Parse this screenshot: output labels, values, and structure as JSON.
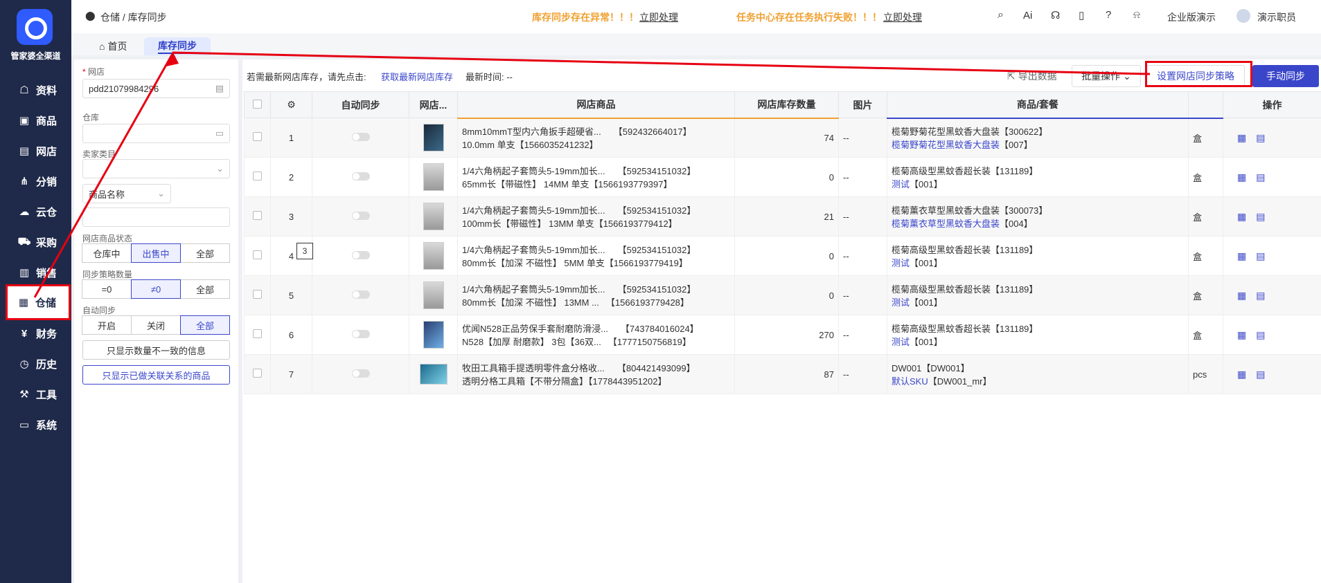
{
  "app": {
    "brand": "管家婆全渠道"
  },
  "sidebar": {
    "items": [
      {
        "label": "资料",
        "icon": "user-icon"
      },
      {
        "label": "商品",
        "icon": "box-icon"
      },
      {
        "label": "网店",
        "icon": "store-icon"
      },
      {
        "label": "分销",
        "icon": "share-icon"
      },
      {
        "label": "云仓",
        "icon": "cloud-warehouse-icon"
      },
      {
        "label": "采购",
        "icon": "cart-icon"
      },
      {
        "label": "销售",
        "icon": "chart-icon"
      },
      {
        "label": "仓储",
        "icon": "warehouse-icon"
      },
      {
        "label": "财务",
        "icon": "finance-icon"
      },
      {
        "label": "历史",
        "icon": "history-icon"
      },
      {
        "label": "工具",
        "icon": "toolbox-icon"
      },
      {
        "label": "系统",
        "icon": "monitor-icon"
      }
    ],
    "active": "仓储"
  },
  "header": {
    "breadcrumb": "仓储 / 库存同步",
    "alert1": "库存同步存在异常！！！",
    "alert1_action": "立即处理",
    "alert2": "任务中心存在任务执行失败！！！",
    "alert2_action": "立即处理",
    "ai_label": "Ai",
    "enterprise": "企业版演示",
    "user": "演示职员"
  },
  "tabs": [
    {
      "label": "首页"
    },
    {
      "label": "库存同步"
    }
  ],
  "filter": {
    "shop_label": "网店",
    "shop_value": "pdd21079984296",
    "warehouse_label": "仓库",
    "category_label": "卖家类目",
    "name_select": "商品名称",
    "status_label": "网店商品状态",
    "status_opts": [
      "仓库中",
      "出售中",
      "全部"
    ],
    "strategy_label": "同步策略数量",
    "strategy_opts": [
      "=0",
      "≠0",
      "全部"
    ],
    "auto_label": "自动同步",
    "auto_opts": [
      "开启",
      "关闭",
      "全部"
    ],
    "btn_mismatch": "只显示数量不一致的信息",
    "btn_linked": "只显示已做关联关系的商品"
  },
  "toolbar": {
    "hint": "若需最新网店库存，请先点击:",
    "hint_link": "获取最新网店库存",
    "latest_time": "最新时间: --",
    "export": "导出数据",
    "batch": "批量操作",
    "set_strategy": "设置网店同步策略",
    "manual_sync": "手动同步"
  },
  "table": {
    "headers": [
      "自动同步",
      "网店...",
      "网店商品",
      "网店库存数量",
      "图片",
      "商品/套餐",
      "操作"
    ],
    "rows": [
      {
        "no": "1",
        "line1": "8mm10mmT型内六角扳手超硬省...",
        "id1": "【592432664017】",
        "line2": "10.0mm 单支【1566035241232】",
        "qty": "74",
        "pic": "--",
        "p1": "榄菊野菊花型黑蚊香大盘装【300622】",
        "p2": "榄菊野菊花型黑蚊香大盘装",
        "p2b": "【007】",
        "unit": "盒",
        "img": "dark"
      },
      {
        "no": "2",
        "line1": "1/4六角柄起子套筒头5-19mm加长...",
        "id1": "【592534151032】",
        "line2": "65mm长【带磁性】 14MM 单支【1566193779397】",
        "qty": "0",
        "pic": "--",
        "p1": "榄菊高级型黑蚊香超长装【131189】",
        "p2": "测试",
        "p2b": "【001】",
        "unit": "盒",
        "img": "grey"
      },
      {
        "no": "3",
        "line1": "1/4六角柄起子套筒头5-19mm加长...",
        "id1": "【592534151032】",
        "line2": "100mm长【带磁性】 13MM 单支【1566193779412】",
        "qty": "21",
        "pic": "--",
        "p1": "榄菊薰衣草型黑蚊香大盘装【300073】",
        "p2": "榄菊薰衣草型黑蚊香大盘装",
        "p2b": "【004】",
        "unit": "盒",
        "img": "grey"
      },
      {
        "no": "4",
        "line1": "1/4六角柄起子套筒头5-19mm加长...",
        "id1": "【592534151032】",
        "line2": "80mm长【加深 不磁性】 5MM 单支【1566193779419】",
        "qty": "0",
        "pic": "--",
        "p1": "榄菊高级型黑蚊香超长装【131189】",
        "p2": "测试",
        "p2b": "【001】",
        "unit": "盒",
        "img": "grey"
      },
      {
        "no": "5",
        "line1": "1/4六角柄起子套筒头5-19mm加长...",
        "id1": "【592534151032】",
        "line2": "80mm长【加深 不磁性】 13MM ...",
        "id2": "【1566193779428】",
        "qty": "0",
        "pic": "--",
        "p1": "榄菊高级型黑蚊香超长装【131189】",
        "p2": "测试",
        "p2b": "【001】",
        "unit": "盒",
        "img": "grey"
      },
      {
        "no": "6",
        "line1": "优闻N528正品劳保手套耐磨防滑浸...",
        "id1": "【743784016024】",
        "line2": "N528【加厚 耐磨款】 3包【36双...",
        "id2": "【1777150756819】",
        "qty": "270",
        "pic": "--",
        "p1": "榄菊高级型黑蚊香超长装【131189】",
        "p2": "测试",
        "p2b": "【001】",
        "unit": "盒",
        "img": "blue"
      },
      {
        "no": "7",
        "line1": "牧田工具箱手提透明零件盒分格收...",
        "id1": "【804421493099】",
        "line2": "透明分格工具箱【不带分隔盒】【1778443951202】",
        "qty": "87",
        "pic": "--",
        "p1": "DW001【DW001】",
        "p2": "默认SKU",
        "p2b": "【DW001_mr】",
        "unit": "pcs",
        "img": "box"
      }
    ]
  },
  "tooltip": "3",
  "colors": {
    "accent": "#3a46c9",
    "sidebar": "#1f2a4a",
    "alert": "#f0a030",
    "annotation": "#e60012"
  }
}
